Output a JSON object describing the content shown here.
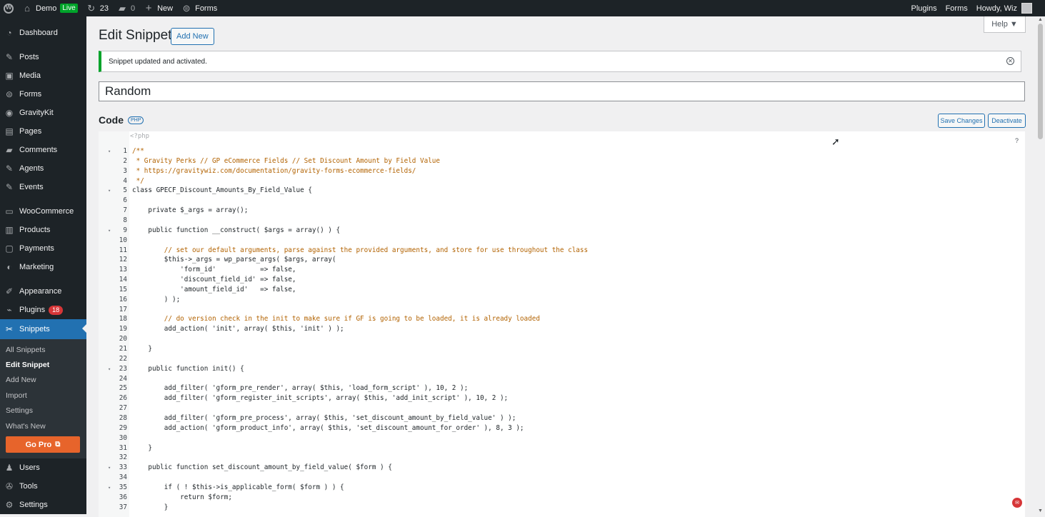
{
  "adminbar": {
    "site_name": "Demo",
    "live_label": "Live",
    "updates_count": "23",
    "comments_count": "0",
    "new_label": "New",
    "forms_label": "Forms",
    "right_plugins": "Plugins",
    "right_forms": "Forms",
    "greeting": "Howdy, Wiz"
  },
  "sidebar": {
    "items": [
      {
        "label": "Dashboard",
        "icon": "dashboard-icon"
      },
      {
        "label": "Posts",
        "icon": "pin-icon"
      },
      {
        "label": "Media",
        "icon": "media-icon"
      },
      {
        "label": "Forms",
        "icon": "forms-icon"
      },
      {
        "label": "GravityKit",
        "icon": "gravitykit-icon"
      },
      {
        "label": "Pages",
        "icon": "pages-icon"
      },
      {
        "label": "Comments",
        "icon": "comments-icon"
      },
      {
        "label": "Agents",
        "icon": "pin-icon"
      },
      {
        "label": "Events",
        "icon": "pin-icon"
      },
      {
        "label": "WooCommerce",
        "icon": "woo-icon"
      },
      {
        "label": "Products",
        "icon": "products-icon"
      },
      {
        "label": "Payments",
        "icon": "payments-icon"
      },
      {
        "label": "Marketing",
        "icon": "marketing-icon"
      },
      {
        "label": "Appearance",
        "icon": "appearance-icon"
      },
      {
        "label": "Plugins",
        "icon": "plugins-icon",
        "badge": "18"
      },
      {
        "label": "Snippets",
        "icon": "snippets-icon"
      }
    ],
    "submenu": [
      "All Snippets",
      "Edit Snippet",
      "Add New",
      "Import",
      "Settings",
      "What's New"
    ],
    "go_pro": "Go Pro",
    "bottom_items": [
      {
        "label": "Users",
        "icon": "users-icon"
      },
      {
        "label": "Tools",
        "icon": "tools-icon"
      },
      {
        "label": "Settings",
        "icon": "settings-icon"
      }
    ]
  },
  "page": {
    "title": "Edit Snippet",
    "add_new": "Add New",
    "help": "Help ▼",
    "notice": "Snippet updated and activated.",
    "snippet_name": "Random",
    "code_heading": "Code",
    "php_tag": "PHP",
    "save_changes": "Save Changes",
    "deactivate": "Deactivate",
    "php_open": "<?php",
    "help_mark": "?"
  },
  "code_lines": [
    {
      "n": "1",
      "fold": true,
      "text": "/**"
    },
    {
      "n": "2",
      "text": " * Gravity Perks // GP eCommerce Fields // Set Discount Amount by Field Value"
    },
    {
      "n": "3",
      "text": " * https://gravitywiz.com/documentation/gravity-forms-ecommerce-fields/"
    },
    {
      "n": "4",
      "text": " */"
    },
    {
      "n": "5",
      "fold": true,
      "text": "class GPECF_Discount_Amounts_By_Field_Value {"
    },
    {
      "n": "6",
      "text": ""
    },
    {
      "n": "7",
      "text": "    private $_args = array();"
    },
    {
      "n": "8",
      "text": ""
    },
    {
      "n": "9",
      "fold": true,
      "text": "    public function __construct( $args = array() ) {"
    },
    {
      "n": "10",
      "text": ""
    },
    {
      "n": "11",
      "text": "        // set our default arguments, parse against the provided arguments, and store for use throughout the class"
    },
    {
      "n": "12",
      "text": "        $this->_args = wp_parse_args( $args, array("
    },
    {
      "n": "13",
      "text": "            'form_id'           => false,"
    },
    {
      "n": "14",
      "text": "            'discount_field_id' => false,"
    },
    {
      "n": "15",
      "text": "            'amount_field_id'   => false,"
    },
    {
      "n": "16",
      "text": "        ) );"
    },
    {
      "n": "17",
      "text": ""
    },
    {
      "n": "18",
      "text": "        // do version check in the init to make sure if GF is going to be loaded, it is already loaded"
    },
    {
      "n": "19",
      "text": "        add_action( 'init', array( $this, 'init' ) );"
    },
    {
      "n": "20",
      "text": ""
    },
    {
      "n": "21",
      "text": "    }"
    },
    {
      "n": "22",
      "text": ""
    },
    {
      "n": "23",
      "fold": true,
      "text": "    public function init() {"
    },
    {
      "n": "24",
      "text": ""
    },
    {
      "n": "25",
      "text": "        add_filter( 'gform_pre_render', array( $this, 'load_form_script' ), 10, 2 );"
    },
    {
      "n": "26",
      "text": "        add_filter( 'gform_register_init_scripts', array( $this, 'add_init_script' ), 10, 2 );"
    },
    {
      "n": "27",
      "text": ""
    },
    {
      "n": "28",
      "text": "        add_filter( 'gform_pre_process', array( $this, 'set_discount_amount_by_field_value' ) );"
    },
    {
      "n": "29",
      "text": "        add_action( 'gform_product_info', array( $this, 'set_discount_amount_for_order' ), 8, 3 );"
    },
    {
      "n": "30",
      "text": ""
    },
    {
      "n": "31",
      "text": "    }"
    },
    {
      "n": "32",
      "text": ""
    },
    {
      "n": "33",
      "fold": true,
      "text": "    public function set_discount_amount_by_field_value( $form ) {"
    },
    {
      "n": "34",
      "text": ""
    },
    {
      "n": "35",
      "fold": true,
      "text": "        if ( ! $this->is_applicable_form( $form ) ) {"
    },
    {
      "n": "36",
      "text": "            return $form;"
    },
    {
      "n": "37",
      "text": "        }"
    }
  ]
}
